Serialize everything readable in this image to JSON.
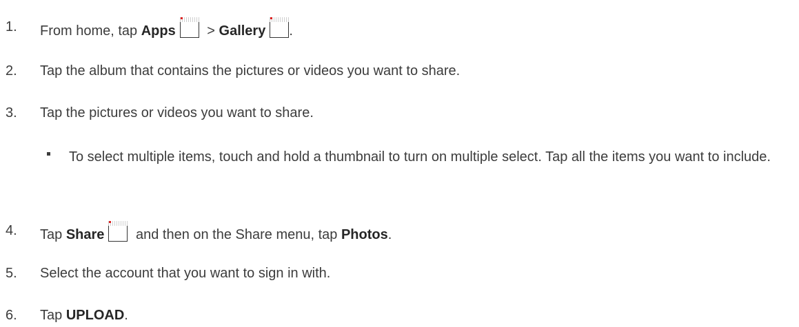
{
  "steps": [
    {
      "num": "1.",
      "parts": {
        "a": "From home, tap ",
        "b": "Apps",
        "c": " > ",
        "d": "Gallery",
        "e": "."
      }
    },
    {
      "num": "2.",
      "text": "Tap the album that contains the pictures or videos you want to share."
    },
    {
      "num": "3.",
      "text": "Tap the pictures or videos you want to share."
    },
    {
      "num": "4.",
      "parts": {
        "a": "Tap ",
        "b": "Share",
        "c": " and then on the Share menu, tap ",
        "d": "Photos",
        "e": "."
      }
    },
    {
      "num": "5.",
      "text": "Select the account that you want to sign in with."
    },
    {
      "num": "6.",
      "parts": {
        "a": "Tap ",
        "b": "UPLOAD",
        "c": "."
      }
    }
  ],
  "bullet": {
    "text": "To select multiple items, touch and hold a thumbnail to turn on multiple select. Tap all the items you want to include."
  },
  "icons": {
    "apps": "apps-icon",
    "gallery": "gallery-icon",
    "share": "share-icon"
  }
}
